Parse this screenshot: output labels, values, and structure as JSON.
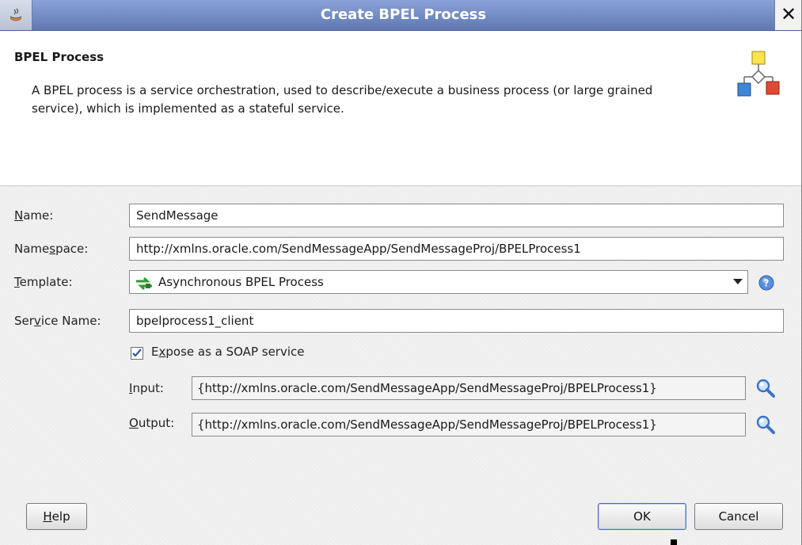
{
  "window": {
    "title": "Create BPEL Process",
    "close_glyph": "✕"
  },
  "header": {
    "title": "BPEL Process",
    "description": "A BPEL process is a service orchestration, used to describe/execute a business process (or large grained service), which is implemented as a stateful service.",
    "icon": "process-diagram-icon"
  },
  "form": {
    "name": {
      "label_pre": "",
      "label_mnemonic": "N",
      "label_post": "ame:",
      "value": "SendMessage"
    },
    "namespace": {
      "label_pre": "Name",
      "label_mnemonic": "s",
      "label_post": "pace:",
      "value": "http://xmlns.oracle.com/SendMessageApp/SendMessageProj/BPELProcess1"
    },
    "template": {
      "label_pre": "",
      "label_mnemonic": "T",
      "label_post": "emplate:",
      "value": "Asynchronous BPEL Process",
      "icon": "async-process-icon"
    },
    "service_name": {
      "label_pre": "Ser",
      "label_mnemonic": "v",
      "label_post": "ice Name:",
      "value": "bpelprocess1_client"
    },
    "expose_soap": {
      "label_pre": "E",
      "label_mnemonic": "x",
      "label_post": "pose as a SOAP service",
      "checked": true
    },
    "input": {
      "label_pre": "",
      "label_mnemonic": "I",
      "label_post": "nput:",
      "value": "{http://xmlns.oracle.com/SendMessageApp/SendMessageProj/BPELProcess1}"
    },
    "output": {
      "label_pre": "",
      "label_mnemonic": "O",
      "label_post": "utput:",
      "value": "{http://xmlns.oracle.com/SendMessageApp/SendMessageProj/BPELProcess1}"
    }
  },
  "buttons": {
    "help": {
      "mnemonic": "H",
      "rest": "elp"
    },
    "ok": "OK",
    "cancel": "Cancel"
  },
  "colors": {
    "title_bar": "#6e86bf",
    "default_button_border": "#4e6cb4"
  }
}
